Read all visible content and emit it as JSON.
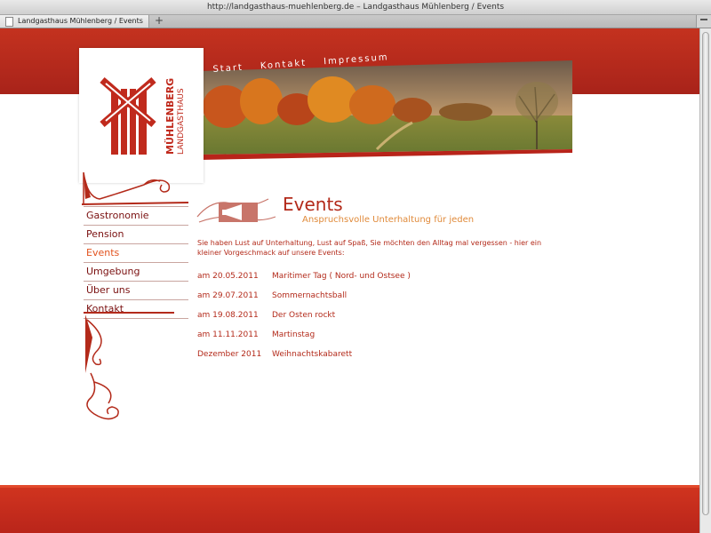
{
  "browser": {
    "url": "http://landgasthaus-muehlenberg.de – Landgasthaus Mühlenberg / Events",
    "tab_title": "Landgasthaus Mühlenberg / Events",
    "new_tab": "+"
  },
  "site": {
    "logo_text": [
      "MÜHLENBERG",
      "LANDGASTHAUS"
    ],
    "top_nav": [
      "Start",
      "Kontakt",
      "Impressum"
    ],
    "side_nav": [
      {
        "label": "Gastronomie",
        "active": false
      },
      {
        "label": "Pension",
        "active": false
      },
      {
        "label": "Events",
        "active": true
      },
      {
        "label": "Umgebung",
        "active": false
      },
      {
        "label": "Über uns",
        "active": false
      },
      {
        "label": "Kontakt",
        "active": false
      }
    ]
  },
  "content": {
    "title": "Events",
    "subtitle": "Anspruchsvolle Unterhaltung für jeden",
    "intro": "Sie haben Lust auf Unterhaltung, Lust auf Spaß, Sie möchten den Alltag mal vergessen - hier ein kleiner Vorgeschmack auf unsere Events:",
    "events": [
      {
        "date": "am 20.05.2011",
        "name": "Maritimer Tag ( Nord- und Ostsee )"
      },
      {
        "date": "am 29.07.2011",
        "name": "Sommernachtsball"
      },
      {
        "date": "am 19.08.2011",
        "name": "Der Osten rockt"
      },
      {
        "date": "am 11.11.2011",
        "name": "Martinstag"
      },
      {
        "date": "Dezember 2011",
        "name": "Weihnachtskabarett"
      }
    ]
  },
  "colors": {
    "brand_red": "#b32a1a",
    "accent_orange": "#e2531f"
  }
}
